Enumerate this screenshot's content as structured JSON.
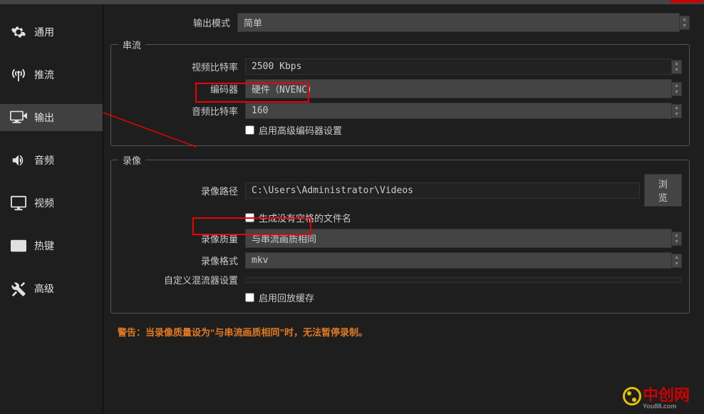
{
  "sidebar": {
    "items": [
      {
        "label": "通用"
      },
      {
        "label": "推流"
      },
      {
        "label": "输出"
      },
      {
        "label": "音频"
      },
      {
        "label": "视频"
      },
      {
        "label": "热键"
      },
      {
        "label": "高级"
      }
    ]
  },
  "output_mode": {
    "label": "输出模式",
    "value": "简单"
  },
  "streaming": {
    "legend": "串流",
    "video_bitrate": {
      "label": "视频比特率",
      "value": "2500 Kbps"
    },
    "encoder": {
      "label": "编码器",
      "value": "硬件（NVENC）"
    },
    "audio_bitrate": {
      "label": "音频比特率",
      "value": "160"
    },
    "advanced_encoder": {
      "label": "启用高级编码器设置"
    }
  },
  "recording": {
    "legend": "录像",
    "path": {
      "label": "录像路径",
      "value": "C:\\Users\\Administrator\\Videos",
      "browse": "浏览"
    },
    "no_space_filename": {
      "label": "生成没有空格的文件名"
    },
    "quality": {
      "label": "录像质量",
      "value": "与串流画质相同"
    },
    "format": {
      "label": "录像格式",
      "value": "mkv"
    },
    "custom_muxer": {
      "label": "自定义混流器设置",
      "value": ""
    },
    "replay_buffer": {
      "label": "启用回放缓存"
    }
  },
  "warning": "警告：当录像质量设为“与串流画质相同”时，无法暂停录制。",
  "logo": {
    "text": "中创网",
    "sub": "You88.com"
  }
}
